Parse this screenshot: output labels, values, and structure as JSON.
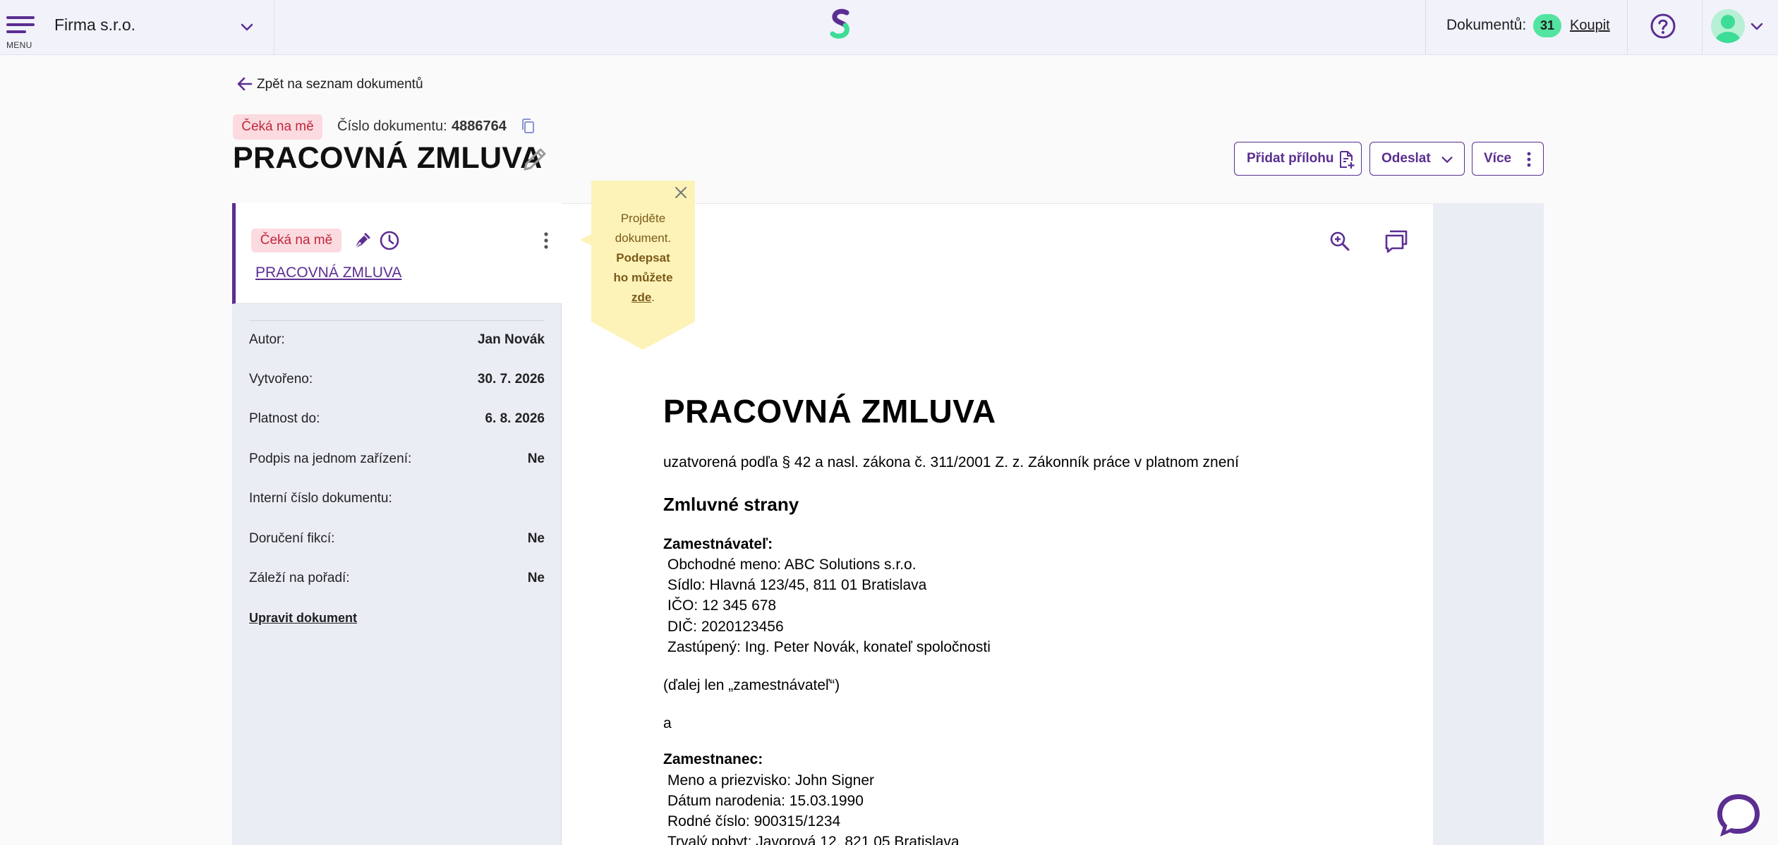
{
  "topbar": {
    "menu_label": "MENU",
    "company": "Firma s.r.o.",
    "documents_label": "Dokumentů:",
    "documents_count": "31",
    "buy_label": "Koupit"
  },
  "header": {
    "back_label": "Zpět na seznam dokumentů",
    "status": "Čeká na mě",
    "docnum_label": "Číslo dokumentu:",
    "docnum_value": "4886764",
    "title": "PRACOVNÁ ZMLUVA",
    "btn_attach": "Přidat přílohu",
    "btn_send": "Odeslat",
    "btn_more": "Více"
  },
  "sidebar": {
    "card_status": "Čeká na mě",
    "card_title": "PRACOVNÁ ZMLUVA",
    "meta": [
      {
        "label": "Autor:",
        "value": "Jan Novák"
      },
      {
        "label": "Vytvořeno:",
        "value": "30. 7. 2026"
      },
      {
        "label": "Platnost do:",
        "value": "6. 8. 2026"
      },
      {
        "label": "Podpis na jednom zařízení:",
        "value": "Ne"
      },
      {
        "label": "Interní číslo dokumentu:",
        "value": ""
      },
      {
        "label": "Doručení fikcí:",
        "value": "Ne"
      },
      {
        "label": "Záleží na pořadí:",
        "value": "Ne"
      }
    ],
    "edit_link": "Upravit dokument"
  },
  "tooltip": {
    "line1": "Projděte",
    "line2": "dokument.",
    "line3": "Podepsat",
    "line4": "ho můžete",
    "link": "zde",
    "end": "."
  },
  "document": {
    "title": "PRACOVNÁ ZMLUVA",
    "subtitle": "uzatvorená podľa § 42 a nasl. zákona č. 311/2001 Z. z. Zákonník práce v platnom znení",
    "parties_heading": "Zmluvné strany",
    "employer_heading": "Zamestnávateľ:",
    "employer_lines": [
      "Obchodné meno: ABC Solutions s.r.o.",
      "Sídlo: Hlavná 123/45, 811 01 Bratislava",
      "IČO: 12 345 678",
      "DIČ: 2020123456",
      "Zastúpený: Ing. Peter Novák, konateľ spoločnosti"
    ],
    "employer_alias": "(ďalej len „zamestnávateľ“)",
    "conjunction": "a",
    "employee_heading": "Zamestnanec:",
    "employee_lines": [
      "Meno a priezvisko: John Signer",
      "Dátum narodenia: 15.03.1990",
      "Rodné číslo: 900315/1234",
      "Trvalý pobyt: Javorová 12, 821 05 Bratislava"
    ]
  },
  "colors": {
    "accent": "#5b2e91",
    "badge_bg": "#fbdbe0",
    "badge_text": "#c0283b",
    "count_badge": "#52e4a0",
    "tooltip_bg": "#fdf3b8"
  }
}
